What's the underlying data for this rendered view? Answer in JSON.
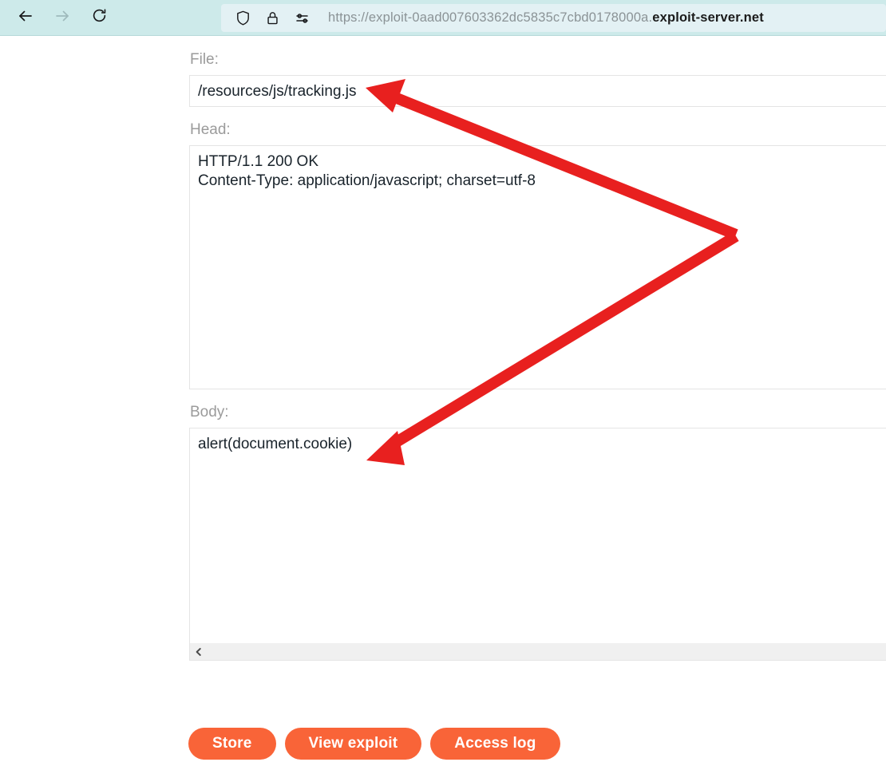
{
  "browser": {
    "back_icon": "arrow-left-icon",
    "forward_icon": "arrow-right-icon",
    "reload_icon": "reload-icon",
    "shield_icon": "shield-icon",
    "lock_icon": "lock-icon",
    "permissions_icon": "permissions-sliders-icon",
    "url_prefix": "https://exploit-0aad007603362dc5835c7cbd0178000a.",
    "url_domain": "exploit-server.net",
    "toolbar_color": "#cdeaea",
    "addressbar_color": "#e3f1f4"
  },
  "form": {
    "file": {
      "label": "File:",
      "value": "/resources/js/tracking.js"
    },
    "head": {
      "label": "Head:",
      "value": "HTTP/1.1 200 OK\nContent-Type: application/javascript; charset=utf-8"
    },
    "body": {
      "label": "Body:",
      "value": "alert(document.cookie)"
    },
    "scrollbar_left_arrow": "chevron-left-icon"
  },
  "buttons": {
    "store": "Store",
    "view_exploit": "View exploit",
    "access_log": "Access log",
    "color": "#f96438"
  },
  "annotations": {
    "arrow_color": "#e8201f",
    "arrow_count": 2,
    "arrow_top_target": "file-input",
    "arrow_bottom_target": "body-textarea"
  }
}
